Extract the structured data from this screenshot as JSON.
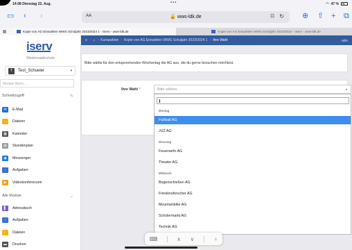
{
  "status_bar": {
    "time": "14:08",
    "date": "Dienstag 22. Aug.",
    "battery": "47 %"
  },
  "safari": {
    "text_size": "AA",
    "url": "wws-ldk.de"
  },
  "tabs": [
    {
      "label": "Kopie von AG Einwahlen WWS Schuljahr 2023/2024 1 - IServ - wws-ldk.de",
      "active": true
    },
    {
      "label": "Kopie von AG Einwahlen WWS Schuljahr 2023/2024 - IServ - wws-ldk.de",
      "active": false
    }
  ],
  "sidebar": {
    "logo": "iserv",
    "school": "Westerwaldschule",
    "user_initial": "T",
    "user": "Test_Schueler",
    "module_filter_placeholder": "Module filtern...",
    "quick_access_title": "Schnellzugriff",
    "quick_access": [
      {
        "label": "E-Mail",
        "icon": "mail-icon",
        "color": "#1e6fd9"
      },
      {
        "label": "Dateien",
        "icon": "folder-icon",
        "color": "#f2b321"
      },
      {
        "label": "Kalender",
        "icon": "calendar-icon",
        "color": "#555555"
      },
      {
        "label": "Stundenplan",
        "icon": "timetable-icon",
        "color": "#999999"
      },
      {
        "label": "Messenger",
        "icon": "messenger-icon",
        "color": "#1f7ae0"
      },
      {
        "label": "Aufgaben",
        "icon": "tasks-icon",
        "color": "#3a6fd8"
      },
      {
        "label": "Videokonferenzen",
        "icon": "video-icon",
        "color": "#f2a11a"
      }
    ],
    "all_modules_title": "Alle Module",
    "all_modules": [
      {
        "label": "Adressbuch",
        "icon": "addressbook-icon",
        "color": "#7b5bd1"
      },
      {
        "label": "Aufgaben",
        "icon": "tasks-icon",
        "color": "#3a6fd8"
      },
      {
        "label": "Dateien",
        "icon": "folder-icon",
        "color": "#f2b321"
      },
      {
        "label": "Drucken",
        "icon": "printer-icon",
        "color": "#555555"
      }
    ]
  },
  "breadcrumb": {
    "items": [
      "Kurswahlen",
      "Kopie von AG Einwahlen WWS Schuljahr 2023/2024 1",
      "Ihre Wahl"
    ],
    "help": "Hilfe"
  },
  "main": {
    "instruction": "Bitte wähle für den entsprechenden Wochentag die AG aus, die du gerne besuchen möchtest.",
    "wahl_label": "Ihre Wahl",
    "required_mark": "*",
    "select_placeholder": "Bitte wählen..."
  },
  "dropdown": {
    "groups": [
      {
        "name": "Montag",
        "options": [
          "Fußball AG",
          "JUZ AG"
        ]
      },
      {
        "name": "Dienstag",
        "options": [
          "Feuerwehr AG",
          "Theater AG"
        ]
      },
      {
        "name": "Mittwoch",
        "options": [
          "Bogenschießen AG",
          "Friedensforscher AG",
          "Mountainbike AG",
          "Schülermarkt AG",
          "Technik AG"
        ]
      }
    ],
    "selected": "Fußball AG"
  },
  "colors": {
    "brand_blue": "#315b9e",
    "highlight": "#3d8ef0"
  }
}
